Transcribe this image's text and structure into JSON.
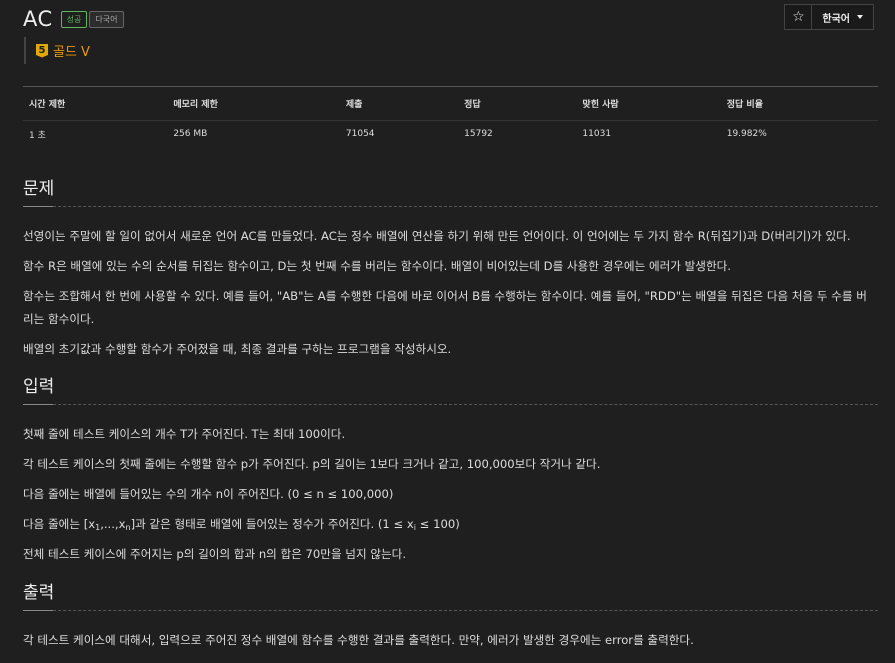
{
  "problem": {
    "title": "AC",
    "badges": {
      "solved": "성공",
      "multilang": "다국어"
    },
    "tier": {
      "level": "5",
      "label": "골드 V",
      "color": "#ec9a00"
    }
  },
  "actions": {
    "star_icon": "☆",
    "language": "한국어"
  },
  "stats": {
    "headers": [
      "시간 제한",
      "메모리 제한",
      "제출",
      "정답",
      "맞힌 사람",
      "정답 비율"
    ],
    "values": [
      "1 초",
      "256 MB",
      "71054",
      "15792",
      "11031",
      "19.982%"
    ]
  },
  "sections": {
    "description": {
      "title": "문제",
      "paragraphs": [
        "선영이는 주말에 할 일이 없어서 새로운 언어 AC를 만들었다. AC는 정수 배열에 연산을 하기 위해 만든 언어이다. 이 언어에는 두 가지 함수 R(뒤집기)과 D(버리기)가 있다.",
        "함수 R은 배열에 있는 수의 순서를 뒤집는 함수이고, D는 첫 번째 수를 버리는 함수이다. 배열이 비어있는데 D를 사용한 경우에는 에러가 발생한다.",
        "함수는 조합해서 한 번에 사용할 수 있다. 예를 들어, \"AB\"는 A를 수행한 다음에 바로 이어서 B를 수행하는 함수이다. 예를 들어, \"RDD\"는 배열을 뒤집은 다음 처음 두 수를 버",
        "리는 함수이다.",
        "배열의 초기값과 수행할 함수가 주어졌을 때, 최종 결과를 구하는 프로그램을 작성하시오."
      ]
    },
    "input": {
      "title": "입력",
      "paragraphs": [
        "첫째 줄에 테스트 케이스의 개수 T가 주어진다. T는 최대 100이다.",
        "각 테스트 케이스의 첫째 줄에는 수행할 함수 p가 주어진다. p의 길이는 1보다 크거나 같고, 100,000보다 작거나 같다.",
        "다음 줄에는 배열에 들어있는 수의 개수 n이 주어진다. (0 ≤ n ≤ 100,000)",
        "전체 테스트 케이스에 주어지는 p의 길이의 합과 n의 합은 70만을 넘지 않는다."
      ],
      "array_line": {
        "before": "다음 줄에는 [x",
        "sub1": "1",
        "mid": ",...,x",
        "subn": "n",
        "after": "]과 같은 형태로 배열에 들어있는 정수가 주어진다. (1 ≤ x",
        "subi": "i",
        "tail": " ≤ 100)"
      }
    },
    "output": {
      "title": "출력",
      "paragraphs": [
        "각 테스트 케이스에 대해서, 입력으로 주어진 정수 배열에 함수를 수행한 결과를 출력한다. 만약, 에러가 발생한 경우에는 error를 출력한다."
      ]
    }
  }
}
